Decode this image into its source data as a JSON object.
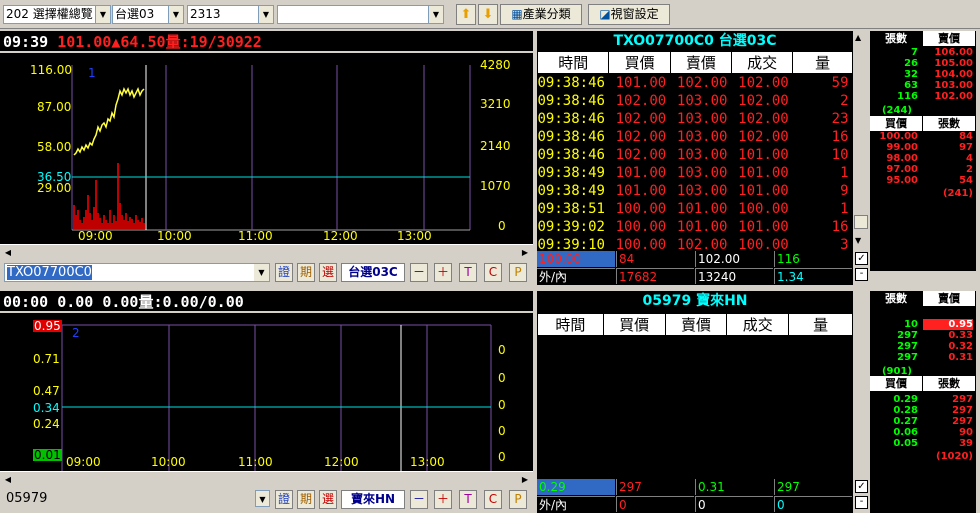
{
  "toolbar": {
    "group_combo": "202 選擇權總覽",
    "market_combo": "台選03",
    "code_combo": "2313",
    "blank_combo": "",
    "industry_label": "產業分類",
    "window_label": "視窗設定"
  },
  "chart1": {
    "header_time": "09:39",
    "header_price": "101.00",
    "header_change": "▲64.50",
    "header_vol": "量:19/30922",
    "index": "1",
    "left_ticks": [
      "116.00",
      "87.00",
      "58.00",
      "36.50",
      "29.00"
    ],
    "right_ticks": [
      "4280",
      "3210",
      "2140",
      "1070",
      "0"
    ],
    "x_ticks": [
      "09:00",
      "10:00",
      "11:00",
      "12:00",
      "13:00"
    ],
    "symbol": "TXO07700C0",
    "market": "台選03C"
  },
  "chart2": {
    "header_time": "00:00",
    "header_price": "0.00",
    "header_change": "0.00",
    "header_vol": "量:0.00/0.00",
    "index": "2",
    "left_ticks": [
      "0.95",
      "0.71",
      "0.47",
      "0.34",
      "0.24",
      "0.01"
    ],
    "right_ticks": [
      "0",
      "0",
      "0",
      "0",
      "0"
    ],
    "x_ticks": [
      "09:00",
      "10:00",
      "11:00",
      "12:00",
      "13:00"
    ],
    "symbol": "05979",
    "market": "寶來HN"
  },
  "btns": {
    "b1": "證",
    "b2": "期",
    "b3": "選",
    "minus": "－",
    "plus": "＋",
    "t": "T",
    "c": "C",
    "p": "P"
  },
  "quote1": {
    "title": "TXO07700C0 台選03C",
    "cols": [
      "時間",
      "買價",
      "賣價",
      "成交",
      "量"
    ],
    "rows": [
      [
        "09:38:46",
        "101.00",
        "102.00",
        "102.00",
        "59"
      ],
      [
        "09:38:46",
        "102.00",
        "103.00",
        "102.00",
        "2"
      ],
      [
        "09:38:46",
        "102.00",
        "103.00",
        "102.00",
        "23"
      ],
      [
        "09:38:46",
        "102.00",
        "103.00",
        "102.00",
        "16"
      ],
      [
        "09:38:46",
        "102.00",
        "103.00",
        "101.00",
        "10"
      ],
      [
        "09:38:49",
        "101.00",
        "103.00",
        "101.00",
        "1"
      ],
      [
        "09:38:49",
        "101.00",
        "103.00",
        "101.00",
        "9"
      ],
      [
        "09:38:51",
        "100.00",
        "101.00",
        "100.00",
        "1"
      ],
      [
        "09:39:02",
        "100.00",
        "101.00",
        "101.00",
        "16"
      ],
      [
        "09:39:10",
        "100.00",
        "102.00",
        "100.00",
        "3"
      ]
    ],
    "bar1": [
      "100.00",
      "84",
      "102.00",
      "116"
    ],
    "bar2": [
      "外/內",
      "17682",
      "13240",
      "1.34"
    ]
  },
  "quote2": {
    "title": "05979 寶來HN",
    "cols": [
      "時間",
      "買價",
      "賣價",
      "成交",
      "量"
    ],
    "bar1": [
      "0.29",
      "297",
      "0.31",
      "297"
    ],
    "bar2": [
      "外/內",
      "0",
      "0",
      "0"
    ]
  },
  "side1": {
    "h1": "張數",
    "h2": "賣價",
    "sells": [
      [
        "7",
        "106.00"
      ],
      [
        "26",
        "105.00"
      ],
      [
        "32",
        "104.00"
      ],
      [
        "63",
        "103.00"
      ],
      [
        "116",
        "102.00"
      ]
    ],
    "sell_total": "(244)",
    "h3": "買價",
    "h4": "張數",
    "buys": [
      [
        "100.00",
        "84"
      ],
      [
        "99.00",
        "97"
      ],
      [
        "98.00",
        "4"
      ],
      [
        "97.00",
        "2"
      ],
      [
        "95.00",
        "54"
      ]
    ],
    "buy_total": "(241)"
  },
  "side2": {
    "h1": "張數",
    "h2": "賣價",
    "sells": [
      [
        "10",
        "0.95"
      ],
      [
        "297",
        "0.33"
      ],
      [
        "297",
        "0.32"
      ],
      [
        "297",
        "0.31"
      ]
    ],
    "sell_total": "(901)",
    "h3": "買價",
    "h4": "張數",
    "buys": [
      [
        "0.29",
        "297"
      ],
      [
        "0.28",
        "297"
      ],
      [
        "0.27",
        "297"
      ],
      [
        "0.06",
        "90"
      ],
      [
        "0.05",
        "39"
      ]
    ],
    "buy_total": "(1020)"
  }
}
